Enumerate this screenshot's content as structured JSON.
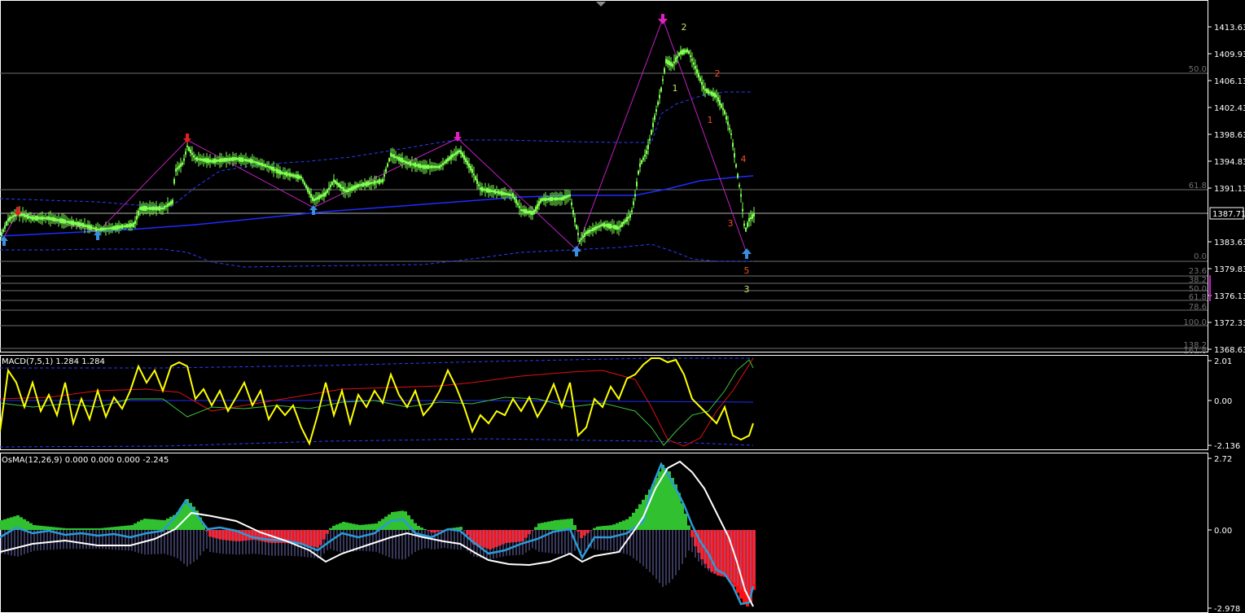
{
  "colors": {
    "background": "#000000",
    "grid": "#8a8a8a",
    "candle": "#7cff4f",
    "zigzag": "#c020c0",
    "band": "#2a3cff",
    "ma": "#1e2cff",
    "macd_main": "#ffff00",
    "macd_signal": "#e01010",
    "macd_green": "#40c040",
    "osma_pos": "#30c030",
    "osma_neg": "#ff1010",
    "osma_line1": "#2a9bd8",
    "osma_line2": "#ffffff",
    "osma_bars": "#6f6fb8",
    "arrow_up": "#3a8ee0",
    "arrow_down_red": "#e02020",
    "arrow_down_magenta": "#e020c0",
    "wave_green": "#c8e26a",
    "wave_orange": "#f05020",
    "price_tag_border": "#ffffff"
  },
  "price_axis": {
    "labels": [
      "1413.63",
      "1409.93",
      "1406.13",
      "1402.43",
      "1398.63",
      "1394.83",
      "1391.13",
      "1387.71",
      "1383.63",
      "1379.83",
      "1376.13",
      "1372.33",
      "1368.63"
    ],
    "current": "1387.71"
  },
  "fib_levels": {
    "upper": [
      {
        "label": "50.0"
      },
      {
        "label": "61.8"
      },
      {
        "label": "0.0"
      }
    ],
    "lower": [
      {
        "label": "23.6"
      },
      {
        "label": "38.2"
      },
      {
        "label": "50.0"
      },
      {
        "label": "61.8"
      },
      {
        "label": "78.6"
      },
      {
        "label": "100.0"
      },
      {
        "label": "138.2"
      },
      {
        "label": "161.8"
      }
    ]
  },
  "wave_labels": [
    {
      "text": "2",
      "color": "green"
    },
    {
      "text": "1",
      "color": "green"
    },
    {
      "text": "2",
      "color": "orange"
    },
    {
      "text": "1",
      "color": "orange"
    },
    {
      "text": "4",
      "color": "orange"
    },
    {
      "text": "3",
      "color": "orange"
    },
    {
      "text": "5",
      "color": "orange"
    },
    {
      "text": "3",
      "color": "green"
    }
  ],
  "macd_panel": {
    "title": "MACD(7,5,1) 1.284 1.284",
    "axis": [
      "2.01",
      "0.00",
      "-2.136"
    ]
  },
  "osma_panel": {
    "title": "OsMA(12,26,9) 0.000 0.000 0.000 -2.245",
    "axis": [
      "2.72",
      "0.00",
      "-2.978"
    ]
  }
}
